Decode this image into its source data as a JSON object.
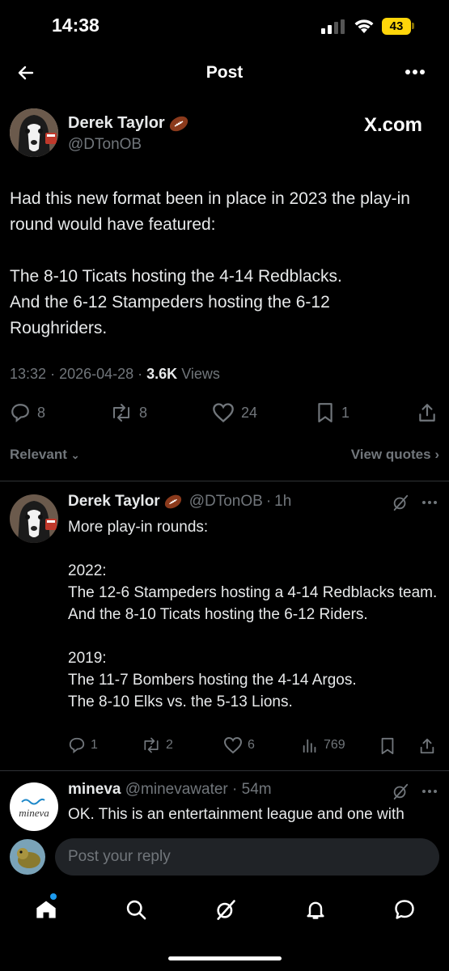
{
  "status": {
    "time": "14:38",
    "battery": "43"
  },
  "nav": {
    "title": "Post"
  },
  "post": {
    "author_name": "Derek Taylor",
    "author_handle": "@DTonOB",
    "source_label": "X.com",
    "text": "Had this new format been in place in 2023 the play-in round would have featured:\n\nThe 8-10 Ticats hosting the 4-14 Redblacks.\nAnd the 6-12 Stampeders hosting the 6-12 Roughriders.",
    "time": "13:32",
    "date": "2026-04-28",
    "views_count": "3.6K",
    "views_label": "Views",
    "replies": "8",
    "reposts": "8",
    "likes": "24",
    "bookmarks": "1"
  },
  "filter": {
    "sort_label": "Relevant",
    "quotes_label": "View quotes"
  },
  "reply1": {
    "author_name": "Derek Taylor",
    "author_handle": "@DTonOB",
    "age": "1h",
    "text": "More play-in rounds:\n\n2022:\nThe 12-6 Stampeders hosting a 4-14 Redblacks team.\nAnd the 8-10 Ticats hosting the 6-12 Riders.\n\n2019:\nThe 11-7 Bombers hosting the 4-14 Argos.\nThe 8-10 Elks vs. the 5-13 Lions.",
    "replies": "1",
    "reposts": "2",
    "likes": "6",
    "views": "769"
  },
  "reply2": {
    "author_name": "mineva",
    "author_handle": "@minevawater",
    "age": "54m",
    "avatar_text": "mineva",
    "text": "OK.  This is an entertainment league and one with"
  },
  "composer": {
    "placeholder": "Post your reply"
  },
  "icons": {
    "back": "arrow-left-icon",
    "more": "more-horizontal-icon",
    "home": "home-icon",
    "search": "search-icon",
    "grok": "grok-icon",
    "notifications": "bell-icon",
    "messages": "chat-bubble-icon"
  }
}
